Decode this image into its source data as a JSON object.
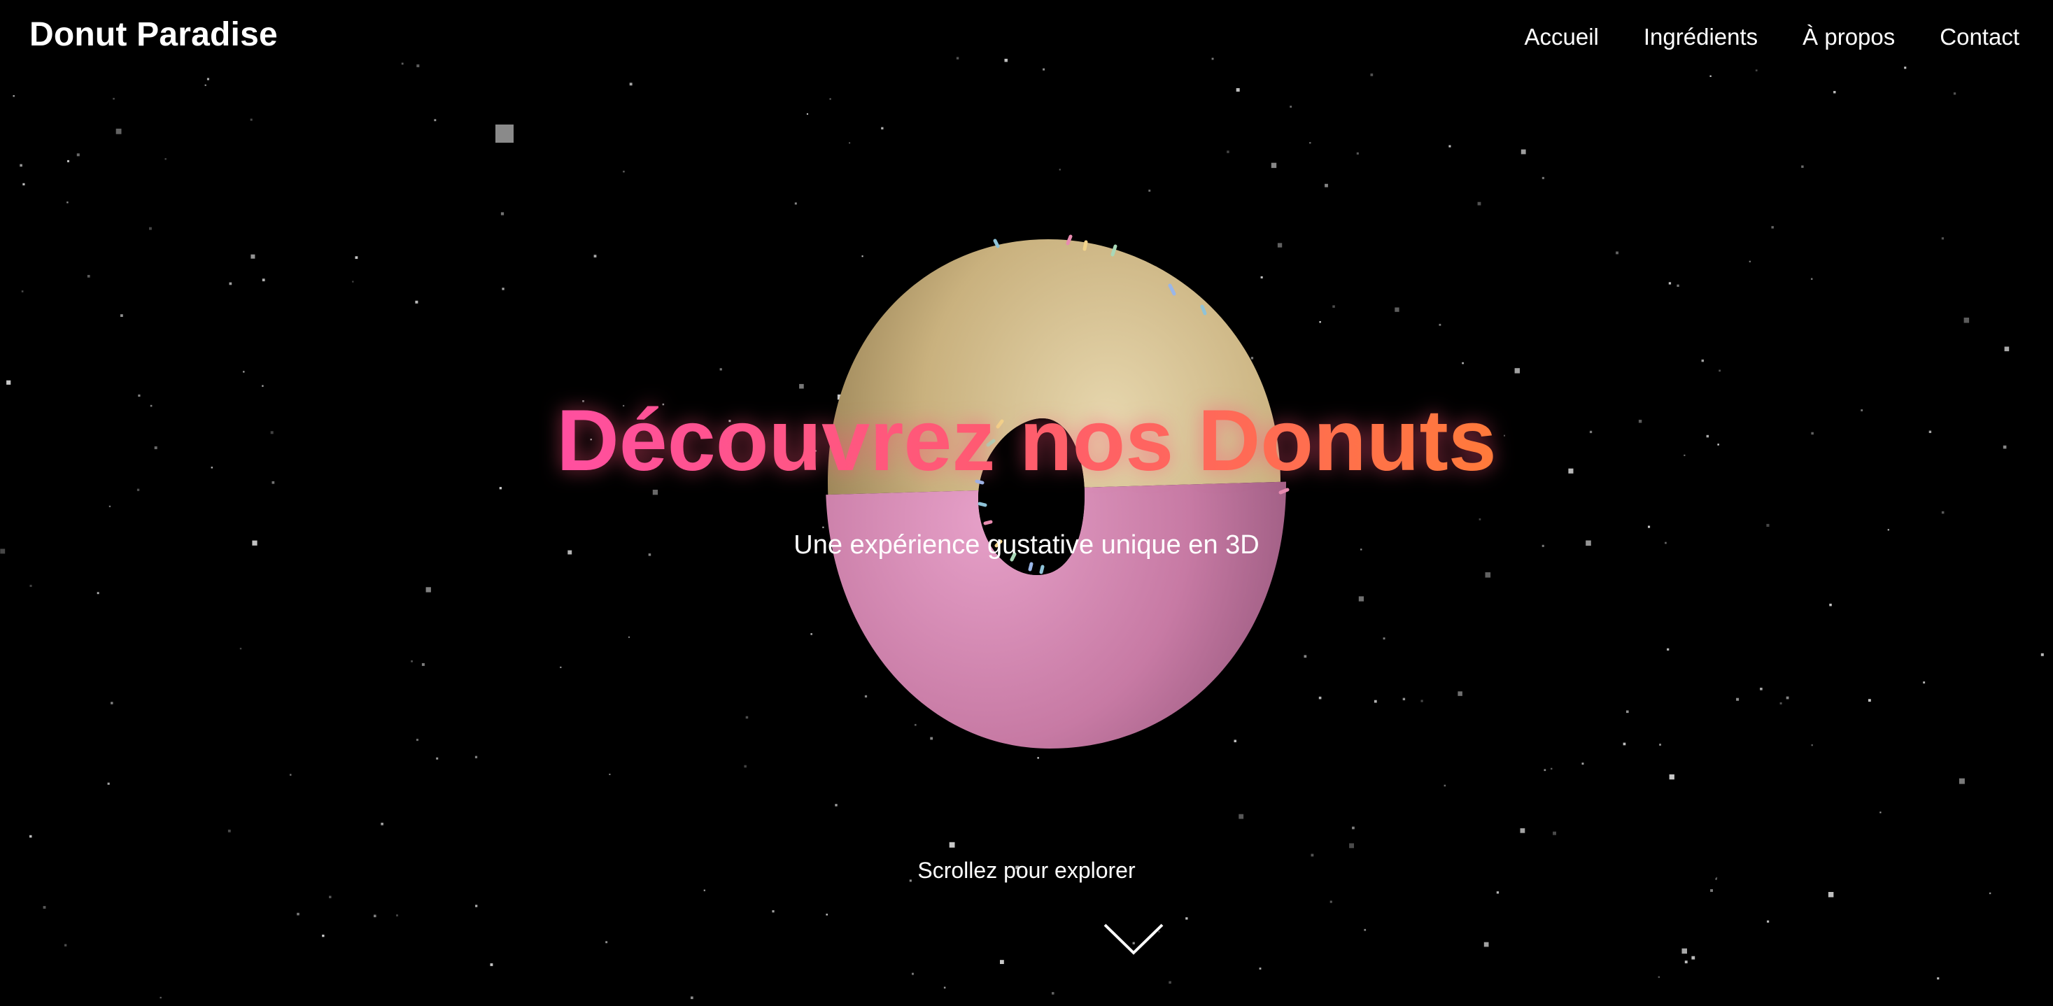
{
  "header": {
    "logo": "Donut Paradise",
    "nav": [
      {
        "label": "Accueil"
      },
      {
        "label": "Ingrédients"
      },
      {
        "label": "À propos"
      },
      {
        "label": "Contact"
      }
    ]
  },
  "hero": {
    "title": "Découvrez nos Donuts",
    "subtitle": "Une expérience gustative unique en 3D",
    "scroll_hint": "Scrollez pour explorer",
    "scroll_icon": "chevron-down-icon"
  },
  "colors": {
    "background": "#000000",
    "title_gradient_start": "#ff4fa0",
    "title_gradient_end": "#ff7a3a",
    "dough": "#d4bf91",
    "icing": "#d27fae",
    "text": "#ffffff"
  }
}
